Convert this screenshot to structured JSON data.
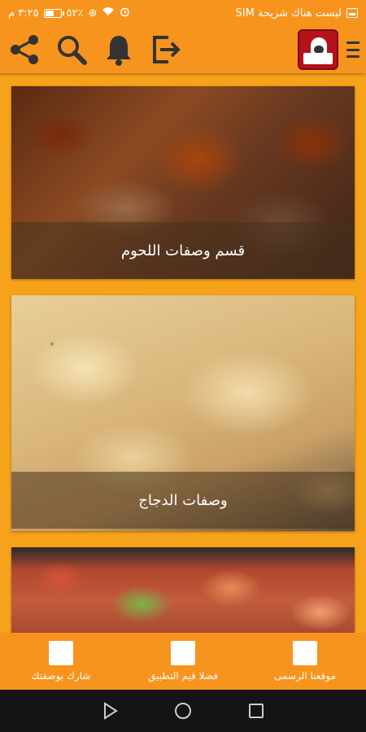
{
  "status_bar": {
    "carrier": "ليست هناك شريحة SIM",
    "time": "٣:٢٥ م",
    "battery": "٥٢٪",
    "battery_level": 0.52
  },
  "toolbar": {
    "icons": [
      "share-icon",
      "search-icon",
      "bell-icon",
      "exit-icon"
    ],
    "menu_icon": "hamburger-icon"
  },
  "cards": [
    {
      "caption": "قسم وصفات اللحوم"
    },
    {
      "caption": "وصفات الدجاج"
    },
    {
      "caption": ""
    }
  ],
  "bottom_bar": {
    "items": [
      {
        "label": "شارك بوصفتك"
      },
      {
        "label": "فضلا قيم التطبيق"
      },
      {
        "label": "موقعنا الرسمى"
      }
    ]
  },
  "colors": {
    "primary": "#f7941d",
    "background": "#f7a21b",
    "nav": "#141414"
  }
}
